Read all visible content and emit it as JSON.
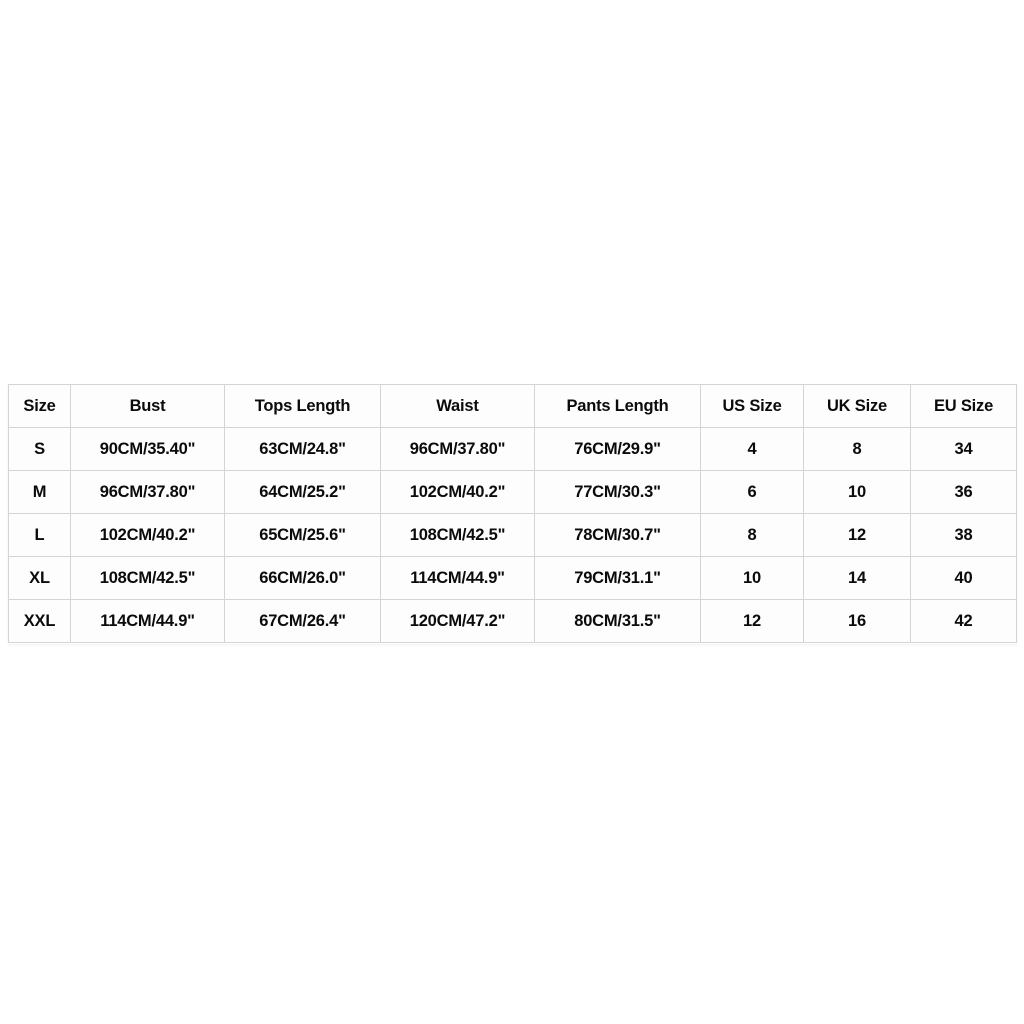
{
  "page": {
    "background_color": "#ffffff",
    "text_color": "#0b0b0b",
    "border_color": "#d4d4d4"
  },
  "size_chart": {
    "columns": [
      "Size",
      "Bust",
      "Tops Length",
      "Waist",
      "Pants Length",
      "US Size",
      "UK Size",
      "EU Size"
    ],
    "rows": [
      {
        "size": "S",
        "bust": "90CM/35.40\"",
        "tops_length": "63CM/24.8\"",
        "waist": "96CM/37.80\"",
        "pants_length": "76CM/29.9\"",
        "us_size": "4",
        "uk_size": "8",
        "eu_size": "34"
      },
      {
        "size": "M",
        "bust": "96CM/37.80\"",
        "tops_length": "64CM/25.2\"",
        "waist": "102CM/40.2\"",
        "pants_length": "77CM/30.3\"",
        "us_size": "6",
        "uk_size": "10",
        "eu_size": "36"
      },
      {
        "size": "L",
        "bust": "102CM/40.2\"",
        "tops_length": "65CM/25.6\"",
        "waist": "108CM/42.5\"",
        "pants_length": "78CM/30.7\"",
        "us_size": "8",
        "uk_size": "12",
        "eu_size": "38"
      },
      {
        "size": "XL",
        "bust": "108CM/42.5\"",
        "tops_length": "66CM/26.0\"",
        "waist": "114CM/44.9\"",
        "pants_length": "79CM/31.1\"",
        "us_size": "10",
        "uk_size": "14",
        "eu_size": "40"
      },
      {
        "size": "XXL",
        "bust": "114CM/44.9\"",
        "tops_length": "67CM/26.4\"",
        "waist": "120CM/47.2\"",
        "pants_length": "80CM/31.5\"",
        "us_size": "12",
        "uk_size": "16",
        "eu_size": "42"
      }
    ]
  }
}
